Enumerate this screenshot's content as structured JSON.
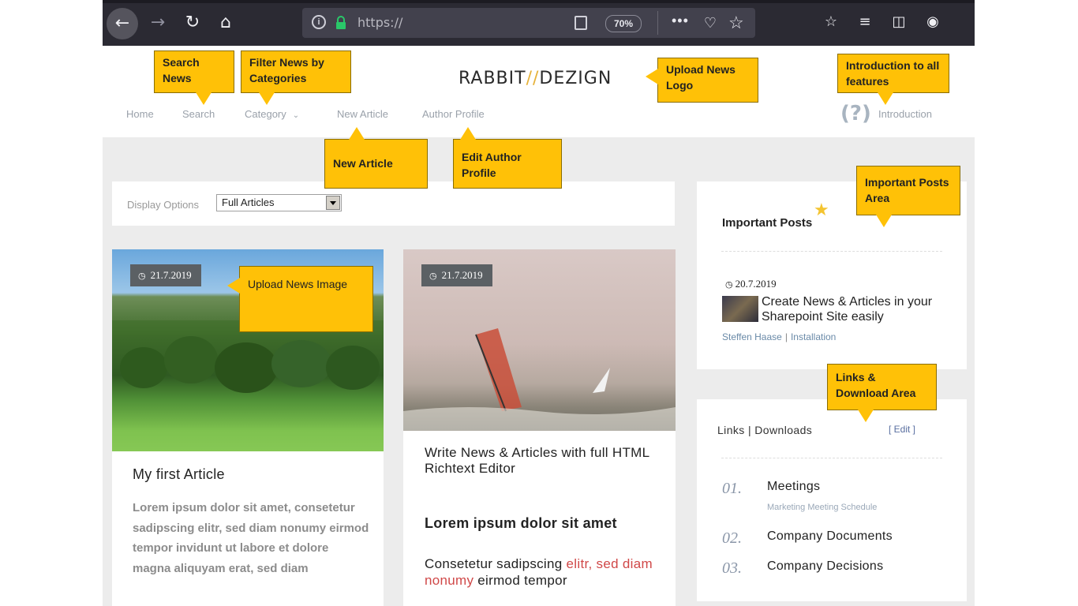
{
  "browser": {
    "url": "https://",
    "zoom": "70%",
    "more_icon": "•••"
  },
  "header": {
    "logo_text_1": "RABBIT",
    "logo_slash": "//",
    "logo_text_2": "DEZIGN",
    "help_icon": "(?)",
    "nav": {
      "home": "Home",
      "search": "Search",
      "category": "Category",
      "new_article": "New Article",
      "author_profile": "Author Profile",
      "introduction": "Introduction"
    }
  },
  "display": {
    "label": "Display Options",
    "selected": "Full Articles"
  },
  "articles": [
    {
      "date": "21.7.2019",
      "title": "My first Article",
      "body": "Lorem ipsum dolor sit amet, consetetur sadipscing elitr, sed diam nonumy eirmod tempor invidunt ut labore et dolore magna aliquyam erat, sed diam"
    },
    {
      "date": "21.7.2019",
      "title": "Write News & Articles with full HTML Richtext Editor",
      "subtitle": "Lorem ipsum dolor sit amet",
      "text_1": "Consetetur sadipscing ",
      "text_red": "elitr, sed diam nonumy",
      "text_2": " eirmod tempor"
    }
  ],
  "important_posts": {
    "title": "Important Posts",
    "date": "20.7.2019",
    "post_title": "Create News & Articles in your Sharepoint Site easily",
    "author": "Steffen Haase",
    "separator": "|",
    "category": "Installation"
  },
  "links": {
    "title": "Links | Downloads",
    "edit": "[ Edit ]",
    "items": [
      {
        "num": "01.",
        "title": "Meetings",
        "sub": "Marketing Meeting Schedule"
      },
      {
        "num": "02.",
        "title": "Company Documents",
        "sub": ""
      },
      {
        "num": "03.",
        "title": "Company Decisions",
        "sub": ""
      }
    ]
  },
  "callouts": {
    "search": "Search News",
    "filter": "Filter News by Categories",
    "logo": "Upload News Logo",
    "intro": "Introduction to all features",
    "new_article": "New Article",
    "author": "Edit Author Profile",
    "important": "Important Posts Area",
    "image": "Upload News Image",
    "links": "Links & Download Area"
  },
  "colors": {
    "callout": "#ffc107",
    "browser_bar": "#2b2a33",
    "accent_red": "#d04848",
    "star": "#f4c430"
  }
}
